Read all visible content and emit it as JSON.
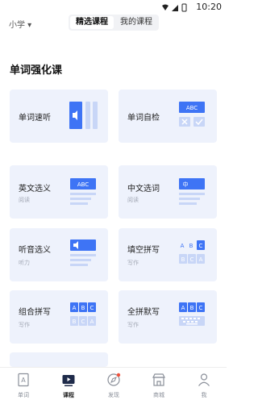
{
  "status": {
    "time": "10:20"
  },
  "header": {
    "grade": "小学 ▾",
    "tabs": [
      "精选课程",
      "我的课程"
    ]
  },
  "section": {
    "title": "单词强化课"
  },
  "cards": [
    {
      "title": "单词速听",
      "sub": ""
    },
    {
      "title": "单词自检",
      "sub": "",
      "badge": "ABC"
    },
    {
      "title": "英文选义",
      "sub": "阅读",
      "badge": "ABC"
    },
    {
      "title": "中文选词",
      "sub": "阅读",
      "badge": "中"
    },
    {
      "title": "听音选义",
      "sub": "听力"
    },
    {
      "title": "填空拼写",
      "sub": "写作",
      "letters_top": [
        "A",
        "B",
        "C"
      ],
      "letters_bottom": [
        "B",
        "C",
        "A"
      ]
    },
    {
      "title": "组合拼写",
      "sub": "写作",
      "letters_top": [
        "A",
        "B",
        "C"
      ],
      "letters_bottom": [
        "B",
        "C",
        "A"
      ]
    },
    {
      "title": "全拼默写",
      "sub": "写作",
      "letters_top": [
        "A",
        "B",
        "C"
      ]
    }
  ],
  "nav": [
    {
      "label": "单词",
      "icon": "book-a-icon"
    },
    {
      "label": "课程",
      "icon": "video-course-icon"
    },
    {
      "label": "发现",
      "icon": "compass-icon"
    },
    {
      "label": "商城",
      "icon": "shop-icon"
    },
    {
      "label": "我",
      "icon": "person-icon"
    }
  ],
  "colors": {
    "accent": "#3e74f5",
    "card_bg": "#eef2fc",
    "light_blue": "#c8d6f7"
  }
}
